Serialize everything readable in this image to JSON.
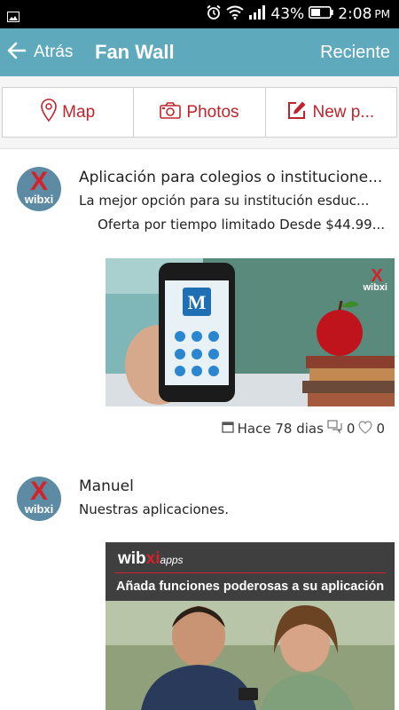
{
  "status_bar": {
    "battery_percent": "43%",
    "time": "2:08",
    "ampm": "PM"
  },
  "app_bar": {
    "back_label": "Atrás",
    "title": "Fan Wall",
    "sort_label": "Reciente"
  },
  "tabs": [
    {
      "label": "Map",
      "icon": "map-pin-icon"
    },
    {
      "label": "Photos",
      "icon": "camera-icon"
    },
    {
      "label": "New p...",
      "icon": "edit-icon"
    }
  ],
  "posts": [
    {
      "author": "Aplicación para colegios o institucione...",
      "body": "La mejor opción para su institución esduc...",
      "extra": "Oferta por tiempo limitado Desde $44.99...",
      "avatar_text": "wibxi",
      "image_brand": "wibxi",
      "date": "Hace 78 dias",
      "comments": "0",
      "likes": "0"
    },
    {
      "author": "Manuel",
      "body": "Nuestras aplicaciones.",
      "avatar_text": "wibxi",
      "image_brand_a": "wib",
      "image_brand_b": "xi",
      "image_brand_c": "apps",
      "image_headline": "Añada funciones poderosas a su aplicación"
    }
  ],
  "colors": {
    "appbar": "#5fa9bd",
    "accent_red": "#c0232b"
  }
}
